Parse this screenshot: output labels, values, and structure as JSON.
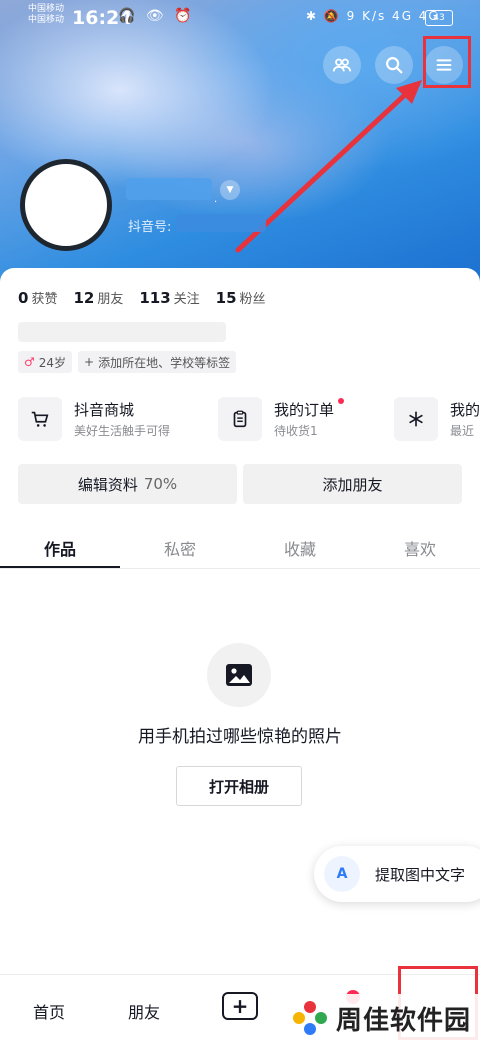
{
  "status_bar": {
    "carrier_1": "中国移动",
    "carrier_2": "中国移动",
    "time": "16:24",
    "icons_left": "🎧 👁 ⏰",
    "icons_right": "✱ 🔕 9 K/s 4G 4G",
    "battery": "43"
  },
  "profile": {
    "douyin_id_label": "抖音号:"
  },
  "stats": [
    {
      "value": "0",
      "label": "获赞"
    },
    {
      "value": "12",
      "label": "朋友"
    },
    {
      "value": "113",
      "label": "关注"
    },
    {
      "value": "15",
      "label": "粉丝"
    }
  ],
  "tags": {
    "age": "24岁",
    "add_tag": "添加所在地、学校等标签"
  },
  "services": [
    {
      "title": "抖音商城",
      "subtitle": "美好生活触手可得"
    },
    {
      "title": "我的订单",
      "subtitle": "待收货1"
    },
    {
      "title": "我的",
      "subtitle": "最近"
    }
  ],
  "actions": {
    "edit_profile": "编辑资料",
    "edit_progress": "70%",
    "add_friends": "添加朋友"
  },
  "tabs": [
    "作品",
    "私密",
    "收藏",
    "喜欢"
  ],
  "empty_state": {
    "message": "用手机拍过哪些惊艳的照片",
    "button": "打开相册"
  },
  "ocr_float": {
    "label": "提取图中文字"
  },
  "bottom_nav": {
    "home": "首页",
    "friends": "朋友"
  },
  "watermark": {
    "text": "周佳软件园"
  },
  "colors": {
    "highlight": "#e8323c",
    "accent_red": "#fe2c55"
  }
}
